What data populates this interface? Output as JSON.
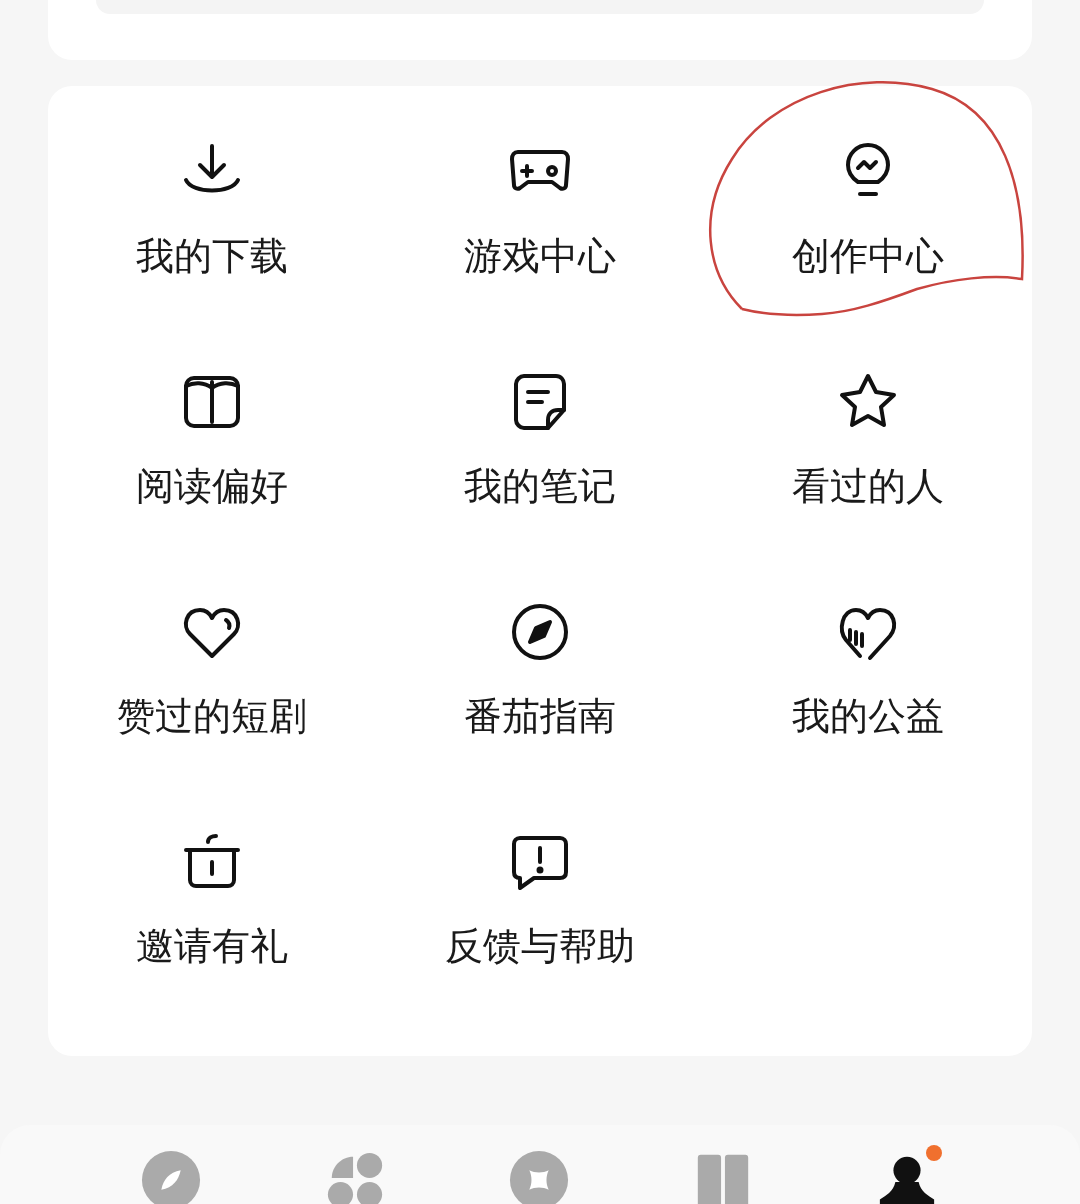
{
  "menu": [
    {
      "label": "我的下载",
      "circled": false
    },
    {
      "label": "游戏中心",
      "circled": false
    },
    {
      "label": "创作中心",
      "circled": true
    },
    {
      "label": "阅读偏好",
      "circled": false
    },
    {
      "label": "我的笔记",
      "circled": false
    },
    {
      "label": "看过的人",
      "circled": false
    },
    {
      "label": "赞过的短剧",
      "circled": false
    },
    {
      "label": "番茄指南",
      "circled": false
    },
    {
      "label": "我的公益",
      "circled": false
    },
    {
      "label": "邀请有礼",
      "circled": false
    },
    {
      "label": "反馈与帮助",
      "circled": false
    }
  ],
  "tab_bar": [
    {
      "selected": false,
      "badge": false
    },
    {
      "selected": false,
      "badge": false
    },
    {
      "selected": false,
      "badge": false
    },
    {
      "selected": false,
      "badge": false
    },
    {
      "selected": true,
      "badge": true
    }
  ]
}
